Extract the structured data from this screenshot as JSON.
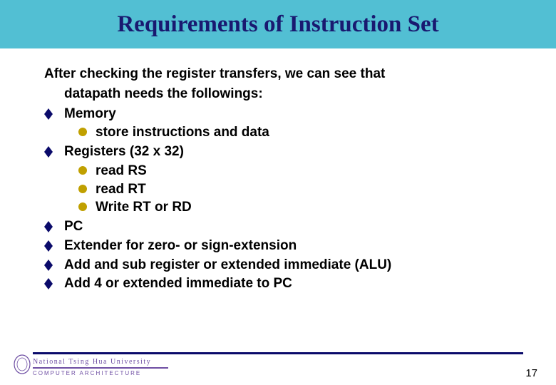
{
  "title": "Requirements of Instruction Set",
  "intro_line1": "After checking the register transfers, we can see that",
  "intro_line2": "datapath needs the followings:",
  "items": {
    "memory": "Memory",
    "memory_sub": {
      "a": "store instructions and data"
    },
    "registers": "Registers (32 x 32)",
    "registers_sub": {
      "a": "read RS",
      "b": "read RT",
      "c": "Write RT or RD"
    },
    "pc": "PC",
    "extender": "Extender for zero- or sign-extension",
    "alu": "Add and sub register or extended immediate (ALU)",
    "adder": "Add 4 or extended immediate to PC"
  },
  "footer": {
    "university": "National Tsing Hua University",
    "dept": "COMPUTER ARCHITECTURE"
  },
  "page_number": "17",
  "colors": {
    "title_bg": "#52bfd3",
    "title_text": "#191970",
    "diamond": "#0a0a6a",
    "disc": "#c0a000",
    "footer_accent": "#6e4ea3"
  }
}
